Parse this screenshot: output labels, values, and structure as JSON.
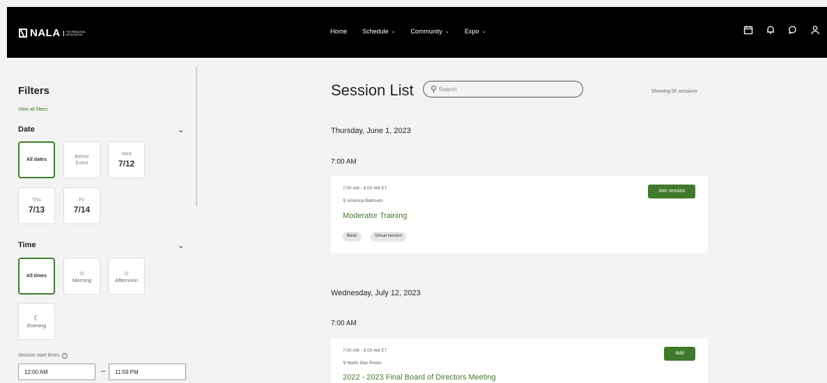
{
  "brand": {
    "name": "NALA",
    "tagline": "THE PARALEGAL ASSOCIATION"
  },
  "nav": {
    "home": "Home",
    "schedule": "Schedule",
    "community": "Community",
    "expo": "Expo"
  },
  "icons": [
    "calendar-icon",
    "bell-icon",
    "chat-icon",
    "user-icon"
  ],
  "filters": {
    "title": "Filters",
    "view_all": "View all filters",
    "date": {
      "title": "Date",
      "all": "All dates",
      "before_small": "Before",
      "before_small2": "Event",
      "wed_day": "Wed",
      "wed_date": "7/12",
      "thu_day": "Thu",
      "thu_date": "7/13",
      "fri_day": "Fri",
      "fri_date": "7/14"
    },
    "time": {
      "title": "Time",
      "all": "All times",
      "morning": "Morning",
      "afternoon": "Afternoon",
      "evening": "Evening"
    },
    "start_label": "Session start times",
    "start_from": "12:00 AM",
    "start_to": "11:59 PM"
  },
  "sessions": {
    "title": "Session List",
    "search_placeholder": "Search",
    "count": "Showing 55 sessions",
    "day1": "Thursday, June 1, 2023",
    "day1_slot": "7:00 AM",
    "s1_time": "7:00 AM - 8:00 AM ET",
    "s1_room": "America Ballroom",
    "s1_name": "Moderator Training",
    "s1_btn": "Join session",
    "s1_tag1": "Basic",
    "s1_tag2": "Virtual session",
    "day2": "Wednesday, July 12, 2023",
    "day2_slot": "7:00 AM",
    "s2_time": "7:00 AM - 8:00 AM ET",
    "s2_room": "North Star Room",
    "s2_name": "2022 - 2023 Final Board of Directors Meeting",
    "s2_btn": "Add"
  },
  "colors": {
    "accent": "#3f7a2c",
    "header": "#000000"
  }
}
